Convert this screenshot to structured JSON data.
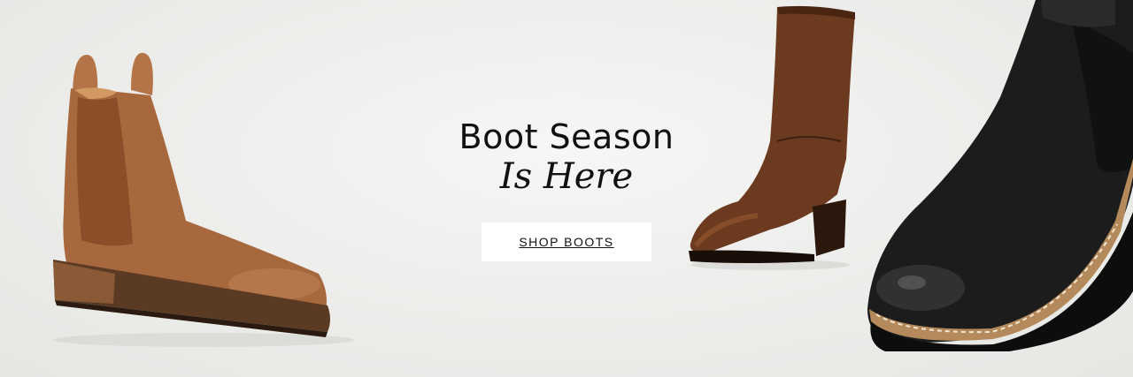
{
  "banner": {
    "headline": "Boot Season",
    "subheadline": "Is Here",
    "cta_label": "SHOP BOOTS"
  },
  "products": [
    {
      "name": "tan-chelsea-boot",
      "color": "#a8683e"
    },
    {
      "name": "brown-tall-boot",
      "color": "#6b3a1f"
    },
    {
      "name": "black-chelsea-boot",
      "color": "#1c1c1c"
    }
  ],
  "colors": {
    "background": "#eeeeec",
    "text": "#111111",
    "button_bg": "#ffffff"
  }
}
